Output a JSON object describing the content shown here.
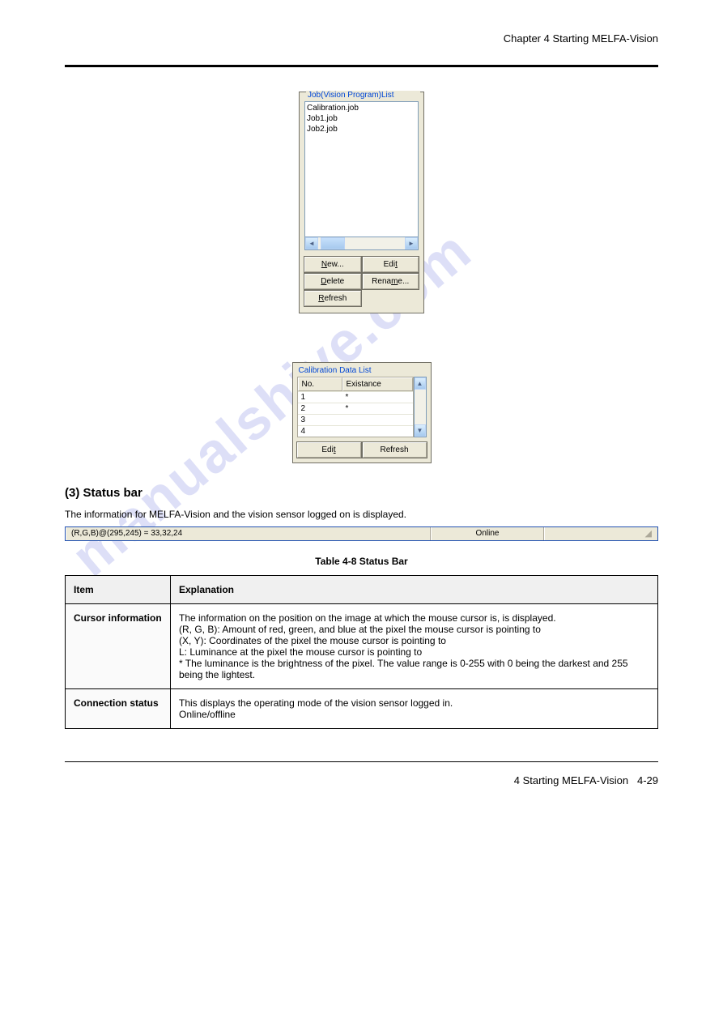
{
  "header": {
    "title": "Chapter 4 Starting MELFA-Vision"
  },
  "footer": {
    "title": "4 Starting MELFA-Vision",
    "page": "4-29"
  },
  "watermark": "manualshive.com",
  "job_panel": {
    "legend": "Job(Vision Program)List",
    "items": [
      "Calibration.job",
      "Job1.job",
      "Job2.job"
    ],
    "buttons": {
      "new": "New...",
      "edit": "Edit",
      "delete": "Delete",
      "rename": "Rename...",
      "refresh": "Refresh"
    }
  },
  "cal_panel": {
    "legend": "Calibration Data List",
    "headers": {
      "no": "No.",
      "existence": "Existance"
    },
    "rows": [
      {
        "no": "1",
        "ex": "*"
      },
      {
        "no": "2",
        "ex": "*"
      },
      {
        "no": "3",
        "ex": ""
      },
      {
        "no": "4",
        "ex": ""
      }
    ],
    "buttons": {
      "edit": "Edit",
      "refresh": "Refresh"
    }
  },
  "section_status": {
    "heading": "(3) Status bar",
    "text": "The information for MELFA-Vision and the vision sensor logged on is displayed."
  },
  "statusbar": {
    "left": "(R,G,B)@(295,245) = 33,32,24",
    "mid": "Online",
    "right": ""
  },
  "table_caption": "Table 4-8 Status Bar",
  "doc_table": {
    "headers": {
      "item": "Item",
      "explanation": "Explanation"
    },
    "rows": [
      {
        "item": "Cursor information",
        "explanation": "The information on the position on the image at which the mouse cursor is, is displayed.\n(R, G, B): Amount of red, green, and blue at the pixel the mouse cursor is pointing to\n(X, Y): Coordinates of the pixel the mouse cursor is pointing to\nL: Luminance at the pixel the mouse cursor is pointing to\n* The luminance is the brightness of the pixel. The value range is 0-255 with 0 being the darkest and 255 being the lightest."
      },
      {
        "item": "Connection status",
        "explanation": "This displays the operating mode of the vision sensor logged in.\nOnline/offline"
      }
    ]
  }
}
